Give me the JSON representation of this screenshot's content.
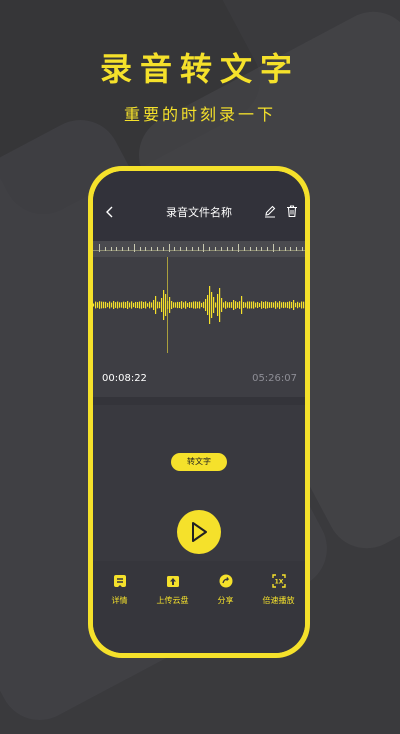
{
  "promo": {
    "title": "录音转文字",
    "subtitle": "重要的时刻录一下"
  },
  "screen": {
    "title": "录音文件名称",
    "time_current": "00:08:22",
    "time_total": "05:26:07",
    "convert_label": "转文字",
    "actions": [
      {
        "label": "详情",
        "icon": "details-icon"
      },
      {
        "label": "上传云盘",
        "icon": "cloud-upload-icon"
      },
      {
        "label": "分享",
        "icon": "share-icon"
      },
      {
        "label": "倍速播放",
        "icon": "speed-icon"
      }
    ]
  },
  "colors": {
    "accent": "#f5e12b",
    "background": "#3a3a3d",
    "screen": "#39393f"
  }
}
